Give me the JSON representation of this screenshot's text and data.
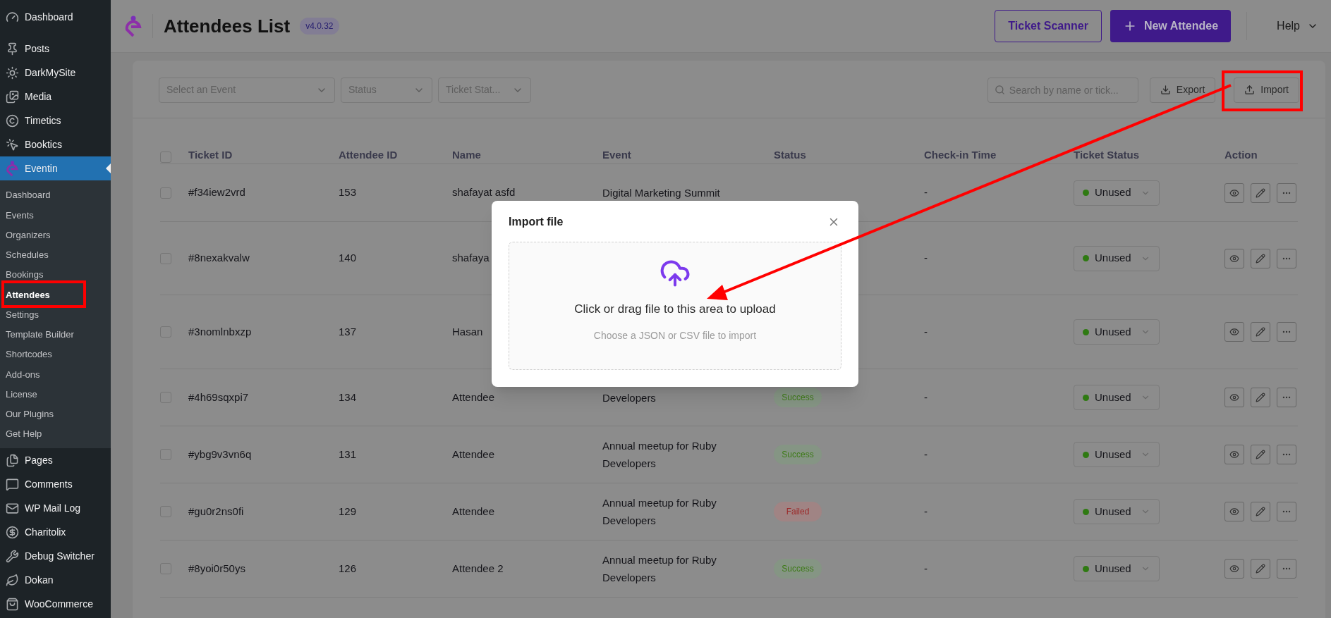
{
  "sidebar": {
    "items": [
      {
        "label": "Dashboard",
        "selected": false
      },
      {
        "label": "Posts",
        "selected": false
      },
      {
        "label": "DarkMySite",
        "selected": false
      },
      {
        "label": "Media",
        "selected": false
      },
      {
        "label": "Timetics",
        "selected": false
      },
      {
        "label": "Booktics",
        "selected": false
      },
      {
        "label": "Eventin",
        "selected": true,
        "children": [
          {
            "label": "Dashboard",
            "selected": false
          },
          {
            "label": "Events",
            "selected": false
          },
          {
            "label": "Organizers",
            "selected": false
          },
          {
            "label": "Schedules",
            "selected": false
          },
          {
            "label": "Bookings",
            "selected": false
          },
          {
            "label": "Attendees",
            "selected": true
          },
          {
            "label": "Settings",
            "selected": false
          },
          {
            "label": "Template Builder",
            "selected": false
          },
          {
            "label": "Shortcodes",
            "selected": false
          },
          {
            "label": "Add-ons",
            "selected": false
          },
          {
            "label": "License",
            "selected": false
          },
          {
            "label": "Our Plugins",
            "selected": false
          },
          {
            "label": "Get Help",
            "selected": false
          }
        ]
      },
      {
        "label": "Pages",
        "selected": false
      },
      {
        "label": "Comments",
        "selected": false
      },
      {
        "label": "WP Mail Log",
        "selected": false
      },
      {
        "label": "Charitolix",
        "selected": false
      },
      {
        "label": "Debug Switcher",
        "selected": false
      },
      {
        "label": "Dokan",
        "selected": false
      },
      {
        "label": "WooCommerce",
        "selected": false
      }
    ]
  },
  "header": {
    "title": "Attendees List",
    "version": "v4.0.32",
    "buttons": [
      {
        "label": "Ticket Scanner",
        "kind": "outline"
      },
      {
        "label": "New Attendee",
        "kind": "primary"
      }
    ],
    "help": "Help"
  },
  "filters": {
    "selects": [
      {
        "placeholder": "Select an Event"
      },
      {
        "placeholder": "Status"
      },
      {
        "placeholder": "Ticket Stat..."
      }
    ],
    "search": {
      "placeholder": "Search by name or tick..."
    },
    "actions": [
      {
        "label": "Export",
        "kind": "export"
      },
      {
        "label": "Import",
        "kind": "import"
      }
    ]
  },
  "table": {
    "select_all": {
      "checked": false
    },
    "columns": [
      "Ticket ID",
      "Attendee ID",
      "Name",
      "Event",
      "Status",
      "Check-in Time",
      "Ticket Status",
      "Action"
    ],
    "rows": [
      {
        "checked": false,
        "ticket_id": "#f34iew2vrd",
        "attendee_id": "153",
        "name": "shafayat asfd",
        "event": "Digital Marketing Summit",
        "checkin": "-",
        "ticket_status": "Unused"
      },
      {
        "checked": false,
        "ticket_id": "#8nexakvalw",
        "attendee_id": "140",
        "name": "shafaya",
        "checkin": "-",
        "ticket_status": "Unused"
      },
      {
        "checked": false,
        "ticket_id": "#3nomlnbxzp",
        "attendee_id": "137",
        "name": "Hasan",
        "checkin": "-",
        "ticket_status": "Unused"
      },
      {
        "checked": false,
        "ticket_id": "#4h69sqxpi7",
        "attendee_id": "134",
        "name": "Attendee",
        "event": "Developers",
        "status": {
          "label": "Success",
          "kind": "success"
        },
        "checkin": "-",
        "ticket_status": "Unused"
      },
      {
        "checked": false,
        "ticket_id": "#ybg9v3vn6q",
        "attendee_id": "131",
        "name": "Attendee",
        "event": "Annual meetup for Ruby Developers",
        "status": {
          "label": "Success",
          "kind": "success"
        },
        "checkin": "-",
        "ticket_status": "Unused"
      },
      {
        "checked": false,
        "ticket_id": "#gu0r2ns0fi",
        "attendee_id": "129",
        "name": "Attendee",
        "event": "Annual meetup for Ruby Developers",
        "status": {
          "label": "Failed",
          "kind": "failed"
        },
        "checkin": "-",
        "ticket_status": "Unused"
      },
      {
        "checked": false,
        "ticket_id": "#8yoi0r50ys",
        "attendee_id": "126",
        "name": "Attendee 2",
        "event": "Annual meetup for Ruby Developers",
        "status": {
          "label": "Success",
          "kind": "success"
        },
        "checkin": "-",
        "ticket_status": "Unused"
      }
    ]
  },
  "modal": {
    "title": "Import file",
    "upload_text": "Click or drag file to this area to upload",
    "hint": "Choose a JSON or CSV file to import"
  }
}
